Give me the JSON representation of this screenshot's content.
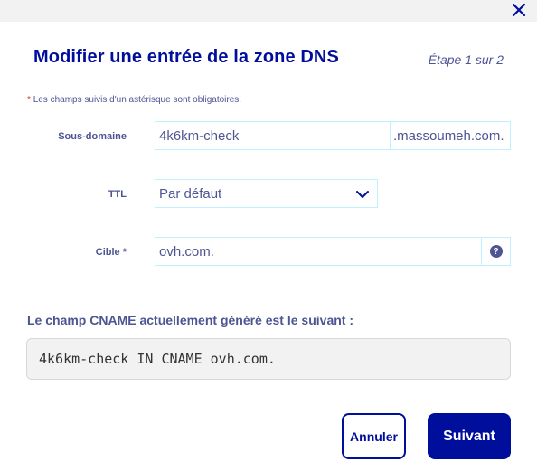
{
  "dialog": {
    "title": "Modifier une entrée de la zone DNS",
    "step": "Étape 1 sur 2",
    "required_note_star": "*",
    "required_note": "Les champs suivis d'un astérisque sont obligatoires."
  },
  "form": {
    "subdomain": {
      "label": "Sous-domaine",
      "value": "4k6km-check",
      "suffix": ".massoumeh.com."
    },
    "ttl": {
      "label": "TTL",
      "selected": "Par défaut"
    },
    "target": {
      "label": "Cible",
      "required_star": "*",
      "value": "ovh.com.",
      "help_glyph": "?"
    }
  },
  "cname": {
    "title": "Le champ CNAME actuellement généré est le suivant :",
    "record": "4k6km-check IN CNAME ovh.com."
  },
  "buttons": {
    "cancel": "Annuler",
    "next": "Suivant"
  },
  "icons": {
    "close": "close-icon",
    "chevron": "chevron-down-icon",
    "help": "help-icon"
  },
  "colors": {
    "primary": "#000e9c",
    "text": "#4d5592",
    "field_border": "#bef1ff",
    "required": "#e2352a",
    "record_bg": "#f2f2f2"
  }
}
